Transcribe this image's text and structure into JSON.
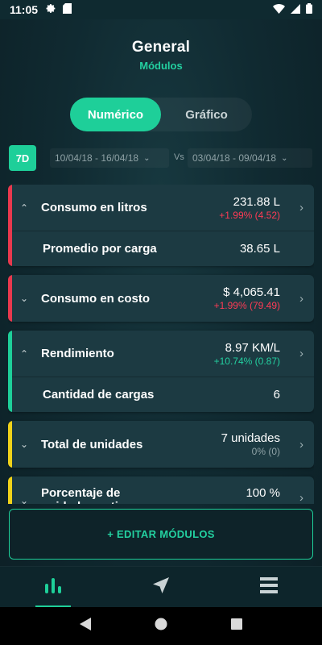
{
  "status_bar": {
    "time": "11:05"
  },
  "header": {
    "title": "General",
    "subtitle": "Módulos"
  },
  "view_toggle": {
    "options": [
      "Numérico",
      "Gráfico"
    ],
    "selected": "Numérico"
  },
  "filters": {
    "period_badge": "7D",
    "range_a": "10/04/18 - 16/04/18",
    "vs_label": "Vs",
    "range_b": "03/04/18 - 09/04/18"
  },
  "modules": [
    {
      "label": "Consumo en litros",
      "value": "231.88 L",
      "delta": "+1.99% (4.52)",
      "expanded": true,
      "accent": "#e8394e",
      "delta_color": "#ff3b55",
      "sub": {
        "label": "Promedio por carga",
        "value": "38.65 L"
      }
    },
    {
      "label": "Consumo en costo",
      "value": "$ 4,065.41",
      "delta": "+1.99% (79.49)",
      "expanded": false,
      "accent": "#e8394e",
      "delta_color": "#ff3b55"
    },
    {
      "label": "Rendimiento",
      "value": "8.97 KM/L",
      "delta": "+10.74% (0.87)",
      "expanded": true,
      "accent": "#1ecf99",
      "delta_color": "#23d0a0",
      "sub": {
        "label": "Cantidad de cargas",
        "value": "6"
      }
    },
    {
      "label": "Total de unidades",
      "value": "7 unidades",
      "delta": "0% (0)",
      "expanded": false,
      "accent": "#f0d21a",
      "delta_color": "#8ea1a5"
    },
    {
      "label": "Porcentaje de unidades activas",
      "value": "100 %",
      "delta": "",
      "expanded": false,
      "accent": "#f0d21a",
      "delta_color": "#8ea1a5"
    }
  ],
  "edit_button": {
    "label": "+ EDITAR MÓDULOS"
  },
  "bottom_nav": {
    "active": "stats"
  },
  "colors": {
    "accent": "#1ecf99",
    "background": "#102a31",
    "card": "#1c3a42"
  }
}
